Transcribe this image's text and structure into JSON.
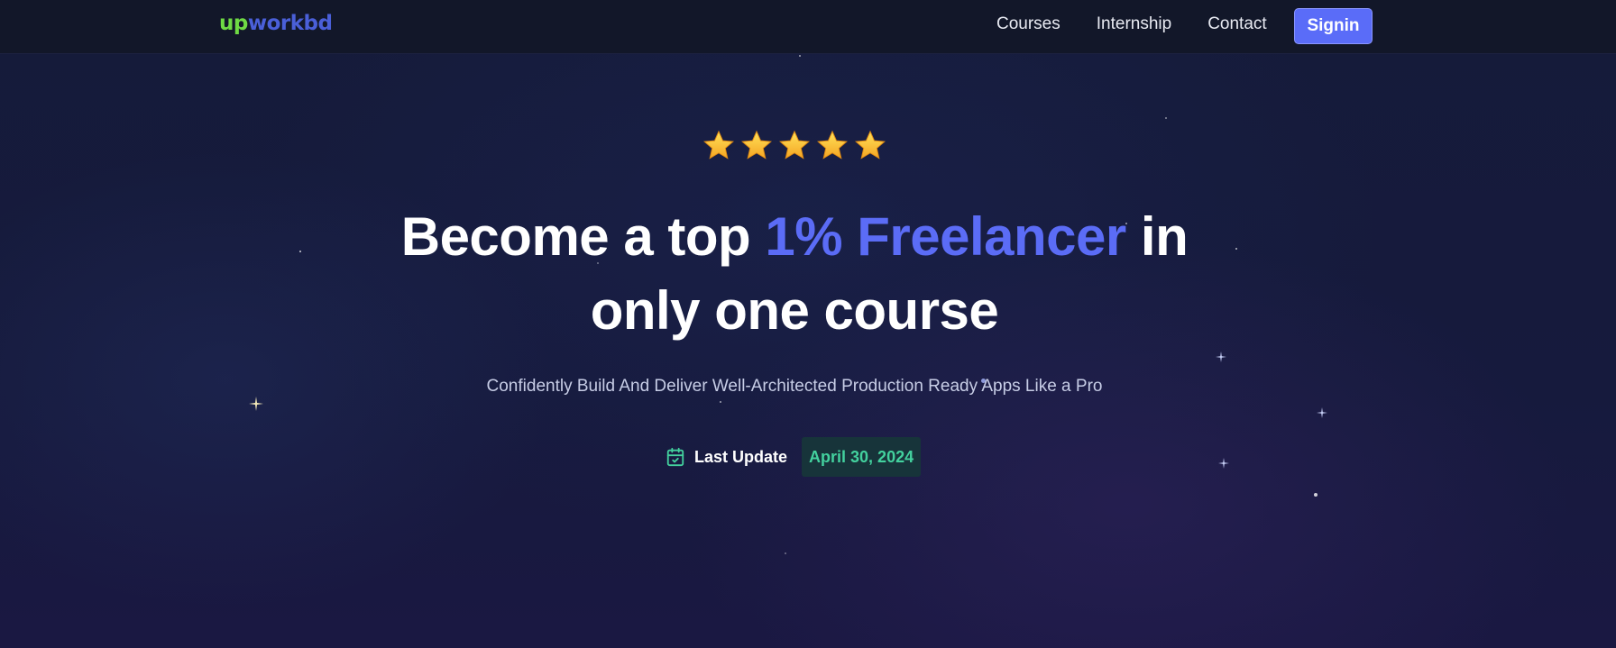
{
  "brand": {
    "logo_part1": "up",
    "logo_part2": "workbd",
    "colors": {
      "up": "#6fda44",
      "rest": "#4a5fd8"
    }
  },
  "nav": {
    "items": [
      {
        "label": "Courses"
      },
      {
        "label": "Internship"
      },
      {
        "label": "Contact"
      }
    ],
    "signin_label": "Signin"
  },
  "hero": {
    "rating_stars": 5,
    "headline_part1": "Become a top",
    "headline_accent": "1% Freelancer",
    "headline_part2": "in",
    "headline_line2": "only one course",
    "subtitle": "Confidently Build And Deliver Well-Architected Production Ready Apps Like a Pro",
    "last_update_label": "Last Update",
    "last_update_date": "April 30, 2024"
  },
  "theme": {
    "accent": "#5b6cf6",
    "button": "#5a6cf8",
    "date_bg": "#17343a",
    "date_text": "#43d19e",
    "icon": "calendar-check-icon"
  }
}
